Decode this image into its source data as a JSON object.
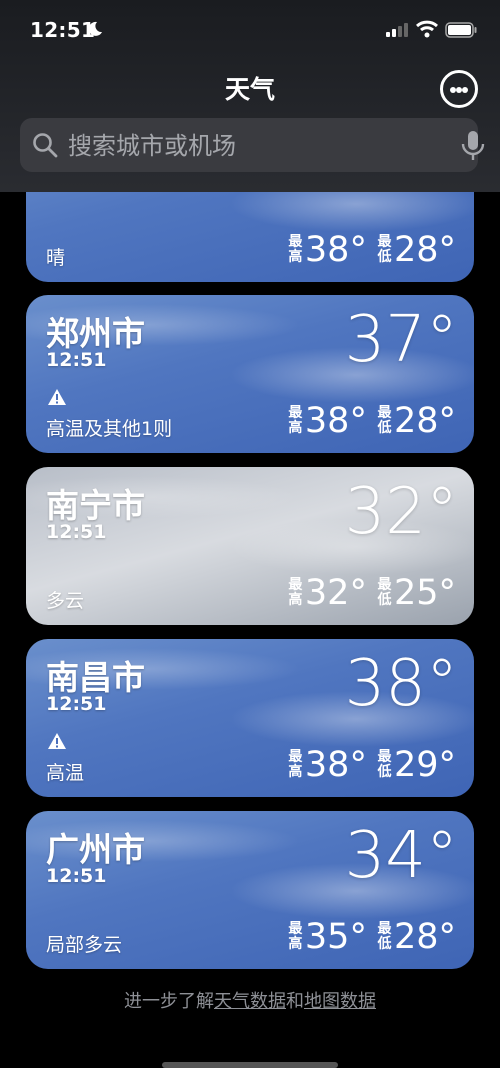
{
  "status_bar": {
    "time": "12:51"
  },
  "header": {
    "title": "天气",
    "search_placeholder": "搜索城市或机场"
  },
  "cards": [
    {
      "city": "",
      "time": "",
      "temp": "",
      "condition": "晴",
      "high_label": "最高",
      "high": "38°",
      "low_label": "最低",
      "low": "28°"
    },
    {
      "city": "郑州市",
      "time": "12:51",
      "temp": "37°",
      "condition": "高温及其他1则",
      "warning": true,
      "high_label": "最高",
      "high": "38°",
      "low_label": "最低",
      "low": "28°"
    },
    {
      "city": "南宁市",
      "time": "12:51",
      "temp": "32°",
      "condition": "多云",
      "high_label": "最高",
      "high": "32°",
      "low_label": "最低",
      "low": "25°"
    },
    {
      "city": "南昌市",
      "time": "12:51",
      "temp": "38°",
      "condition": "高温",
      "warning": true,
      "high_label": "最高",
      "high": "38°",
      "low_label": "最低",
      "low": "29°"
    },
    {
      "city": "广州市",
      "time": "12:51",
      "temp": "34°",
      "condition": "局部多云",
      "high_label": "最高",
      "high": "35°",
      "low_label": "最低",
      "low": "28°"
    }
  ],
  "footer": {
    "prefix": "进一步了解",
    "link_weather": "天气数据",
    "middle": "和",
    "link_map": "地图数据"
  }
}
